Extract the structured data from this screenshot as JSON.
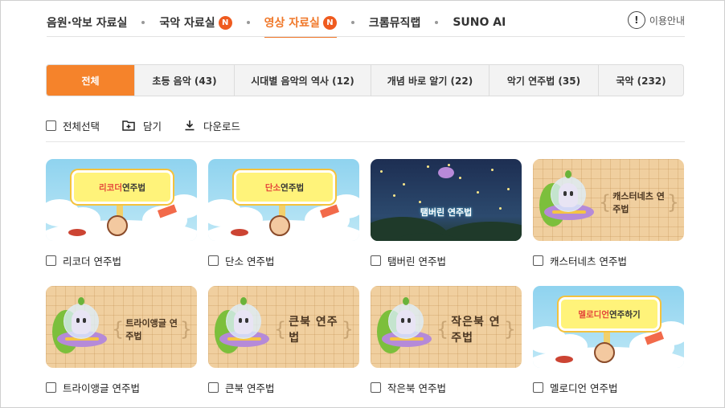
{
  "topnav": {
    "items": [
      {
        "label": "음원·악보 자료실",
        "badge": ""
      },
      {
        "label": "국악 자료실",
        "badge": "N"
      },
      {
        "label": "영상 자료실",
        "badge": "N"
      },
      {
        "label": "크롬뮤직랩",
        "badge": ""
      },
      {
        "label": "SUNO AI",
        "badge": ""
      }
    ],
    "active_index": 2,
    "guide_label": "이용안내",
    "guide_icon": "!"
  },
  "tabs": [
    {
      "label": "전체",
      "active": true
    },
    {
      "label": "초등 음악 (43)",
      "active": false
    },
    {
      "label": "시대별 음악의 역사 (12)",
      "active": false
    },
    {
      "label": "개념 바로 알기 (22)",
      "active": false
    },
    {
      "label": "악기 연주법 (35)",
      "active": false
    },
    {
      "label": "국악 (232)",
      "active": false
    }
  ],
  "toolbar": {
    "select_all": "전체선택",
    "add": "담기",
    "download": "다운로드"
  },
  "cards": [
    {
      "label": "리코더 연주법",
      "thumb_type": "sky",
      "thumb_title_hl": "리코더",
      "thumb_title": " 연주법"
    },
    {
      "label": "단소 연주법",
      "thumb_type": "sky",
      "thumb_title_hl": "단소",
      "thumb_title": " 연주법"
    },
    {
      "label": "탬버린 연주법",
      "thumb_type": "night",
      "thumb_title_hl": "",
      "thumb_title": "탬버린 연주법"
    },
    {
      "label": "캐스터네츠 연주법",
      "thumb_type": "waffle",
      "thumb_title_hl": "",
      "thumb_title": "캐스터네츠 연주법"
    },
    {
      "label": "트라이앵글 연주법",
      "thumb_type": "waffle",
      "thumb_title_hl": "",
      "thumb_title": "트라이앵글 연주법"
    },
    {
      "label": "큰북 연주법",
      "thumb_type": "waffle-big",
      "thumb_title_hl": "",
      "thumb_title": "큰북 연주법"
    },
    {
      "label": "작은북 연주법",
      "thumb_type": "waffle-big",
      "thumb_title_hl": "",
      "thumb_title": "작은북 연주법"
    },
    {
      "label": "멜로디언 연주법",
      "thumb_type": "sky",
      "thumb_title_hl": "멜로디언",
      "thumb_title": " 연주하기"
    }
  ],
  "colors": {
    "accent": "#f5832b",
    "badge": "#ef5b1f",
    "active_nav": "#f0782a"
  },
  "icons": {
    "add": "folder-plus-icon",
    "download": "download-icon",
    "guide": "info-icon"
  }
}
